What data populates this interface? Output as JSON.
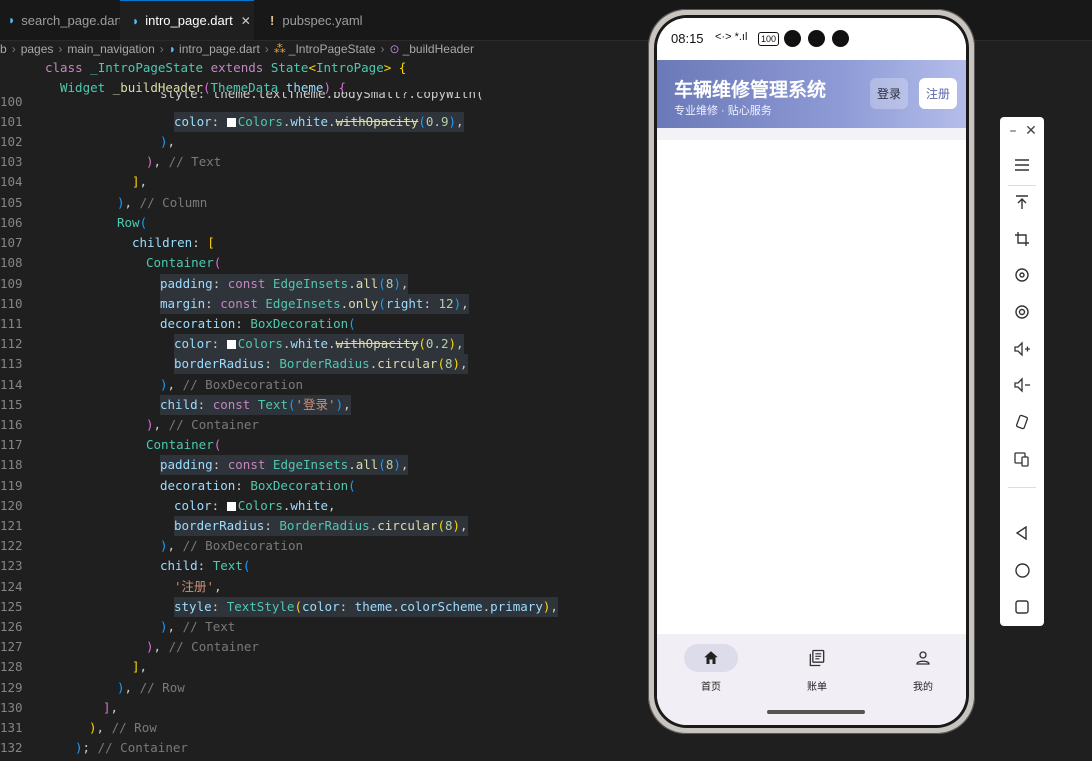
{
  "tabs": [
    {
      "label": "search_page.dart",
      "active": false
    },
    {
      "label": "intro_page.dart",
      "active": true
    },
    {
      "label": "pubspec.yaml",
      "active": false
    }
  ],
  "breadcrumb": [
    "b",
    "pages",
    "main_navigation",
    "intro_page.dart",
    "_IntroPageState",
    "_buildHeader"
  ],
  "code": {
    "sticky1": "class _IntroPageState extends State<IntroPage> {",
    "sticky2": "Widget _buildHeader(ThemeData theme) {",
    "first_line_partial": "style: theme.textTheme.bodySmall?.copyWith(",
    "line_numbers": [
      "100",
      "101",
      "102",
      "103",
      "104",
      "105",
      "106",
      "107",
      "108",
      "109",
      "110",
      "111",
      "112",
      "113",
      "114",
      "115",
      "116",
      "117",
      "118",
      "119",
      "120",
      "121",
      "122",
      "123",
      "124",
      "125",
      "126",
      "127",
      "128",
      "129",
      "130",
      "131",
      "132"
    ]
  },
  "phone": {
    "status_time": "08:15",
    "status_network": "<·> *.ıl",
    "status_battery": "100",
    "app_title": "车辆维修管理系统",
    "app_subtitle": "专业维修 · 贴心服务",
    "login_label": "登录",
    "register_label": "注册",
    "nav": [
      {
        "label": "首页",
        "icon": "home-icon",
        "selected": true
      },
      {
        "label": "账单",
        "icon": "bill-icon",
        "selected": false
      },
      {
        "label": "我的",
        "icon": "person-icon",
        "selected": false
      }
    ]
  },
  "toolbar": {
    "header": [
      "minimize",
      "close"
    ],
    "items": [
      "menu-icon",
      "pin-top-icon",
      "crop-icon",
      "rotate-icon",
      "screenshot-icon",
      "volume-up-icon",
      "volume-down-icon",
      "rotate-device-icon",
      "multi-screen-icon",
      "back-icon",
      "home-circle-icon",
      "overview-icon"
    ]
  },
  "colors": {
    "accent": "#0078d4",
    "appbar_start": "#6b79b8",
    "appbar_end": "#b4bdea"
  }
}
